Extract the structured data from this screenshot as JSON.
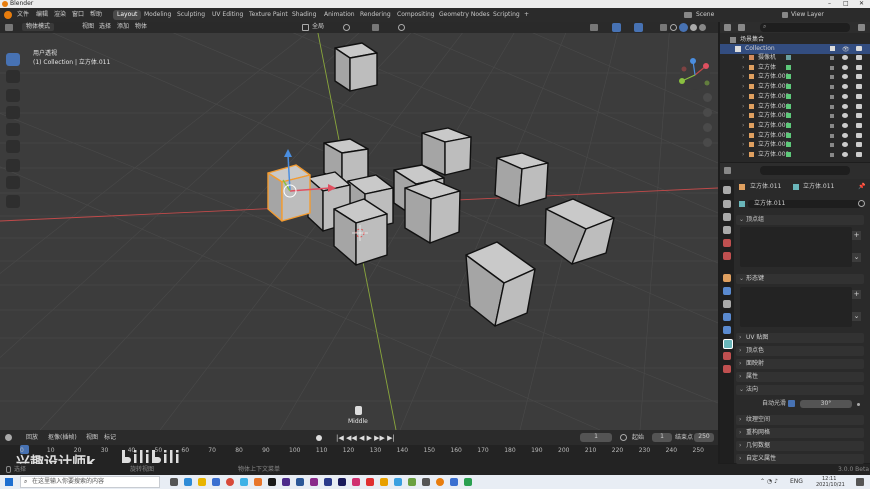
{
  "window": {
    "title": "Blender"
  },
  "menubar": {
    "items": [
      "文件",
      "编辑",
      "渲染",
      "窗口",
      "帮助"
    ],
    "workspaces": [
      {
        "label": "Layout",
        "active": true
      },
      {
        "label": "Modeling"
      },
      {
        "label": "Sculpting"
      },
      {
        "label": "UV Editing"
      },
      {
        "label": "Texture Paint"
      },
      {
        "label": "Shading"
      },
      {
        "label": "Animation"
      },
      {
        "label": "Rendering"
      },
      {
        "label": "Compositing"
      },
      {
        "label": "Geometry Nodes"
      },
      {
        "label": "Scripting"
      }
    ],
    "add_tab": "+",
    "scene": "Scene",
    "view_layer": "View Layer"
  },
  "viewport_header": {
    "mode": "物体模式",
    "menus": [
      "视图",
      "选择",
      "添加",
      "物体"
    ],
    "transform": "全局",
    "options": "选项"
  },
  "viewport": {
    "view_name": "用户透视",
    "collection_info": "(1) Collection | 立方体.011",
    "mouse_hint": "Middle"
  },
  "outliner": {
    "search_placeholder": "",
    "root": "场景集合",
    "collection": "Collection",
    "items": [
      {
        "label": "摄像机",
        "color": "#d38b5d"
      },
      {
        "label": "立方体",
        "color": "#e0a060"
      },
      {
        "label": "立方体.001",
        "color": "#e0a060"
      },
      {
        "label": "立方体.002",
        "color": "#e0a060"
      },
      {
        "label": "立方体.003",
        "color": "#e0a060"
      },
      {
        "label": "立方体.004",
        "color": "#e0a060"
      },
      {
        "label": "立方体.005",
        "color": "#e0a060"
      },
      {
        "label": "立方体.006",
        "color": "#e0a060"
      },
      {
        "label": "立方体.007",
        "color": "#e0a060"
      },
      {
        "label": "立方体.008",
        "color": "#e0a060"
      },
      {
        "label": "立方体.009",
        "color": "#e0a060"
      }
    ]
  },
  "properties": {
    "object_name": "立方体.011",
    "mesh_name": "立方体.011",
    "data_field": "立方体.011",
    "panels": {
      "vertex_groups": "顶点组",
      "shape_keys": "形态键",
      "uv_maps": "UV 贴图",
      "vertex_colors": "顶点色",
      "face_maps": "面映射",
      "attributes": "属性",
      "normals": "法向",
      "texture_space": "纹理空间",
      "remesh": "重构网格",
      "geometry_data": "几何数据",
      "custom_props": "自定义属性"
    },
    "auto_smooth_label": "自动光滑",
    "auto_smooth_angle": "30°"
  },
  "timeline": {
    "menus": [
      "回放",
      "抠像(插帧)",
      "视图",
      "标记"
    ],
    "current_frame": "1",
    "start_label": "起始",
    "start": "1",
    "end_label": "结束点",
    "end": "250",
    "ticks": [
      "0",
      "10",
      "20",
      "30",
      "40",
      "50",
      "60",
      "70",
      "80",
      "90",
      "100",
      "110",
      "120",
      "130",
      "140",
      "150",
      "160",
      "170",
      "180",
      "190",
      "200",
      "210",
      "220",
      "230",
      "240",
      "250"
    ]
  },
  "statusbar": {
    "left": "选择",
    "mid1": "旋转视图",
    "mid2": "物体上下文菜单",
    "version": "3.0.0 Beta"
  },
  "watermark": {
    "text": "兴趣设计师k"
  },
  "taskbar": {
    "search_placeholder": "在这里输入你要搜索的内容",
    "time": "12:11",
    "date": "2021/10/21",
    "lang": "ENG"
  },
  "colors": {
    "accent": "#4772b3",
    "selected_outline": "#f39c32",
    "axis_x": "#c14a4a",
    "axis_y": "#8aa73c"
  }
}
